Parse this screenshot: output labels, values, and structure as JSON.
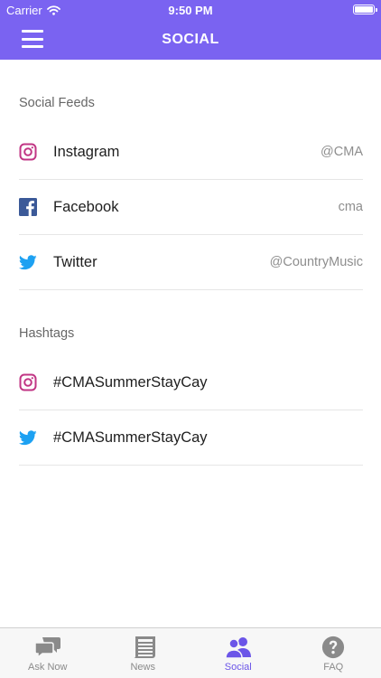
{
  "status_bar": {
    "carrier": "Carrier",
    "time": "9:50 PM"
  },
  "header": {
    "title": "SOCIAL"
  },
  "feeds": {
    "section_title": "Social Feeds",
    "items": [
      {
        "label": "Instagram",
        "handle": "@CMA",
        "icon": "instagram-icon"
      },
      {
        "label": "Facebook",
        "handle": "cma",
        "icon": "facebook-icon"
      },
      {
        "label": "Twitter",
        "handle": "@CountryMusic",
        "icon": "twitter-icon"
      }
    ]
  },
  "hashtags": {
    "section_title": "Hashtags",
    "items": [
      {
        "label": "#CMASummerStayCay",
        "icon": "instagram-icon"
      },
      {
        "label": "#CMASummerStayCay",
        "icon": "twitter-icon"
      }
    ]
  },
  "tabs": [
    {
      "label": "Ask Now",
      "icon": "chat-bubbles-icon",
      "active": false
    },
    {
      "label": "News",
      "icon": "newspaper-icon",
      "active": false
    },
    {
      "label": "Social",
      "icon": "people-icon",
      "active": true
    },
    {
      "label": "FAQ",
      "icon": "question-icon",
      "active": false
    }
  ],
  "colors": {
    "header": "#7a63f1",
    "instagram": "#c13584",
    "facebook": "#3b5998",
    "twitter": "#1da1f2",
    "tab_active": "#6b55e8",
    "tab_inactive": "#8a8a8a"
  }
}
